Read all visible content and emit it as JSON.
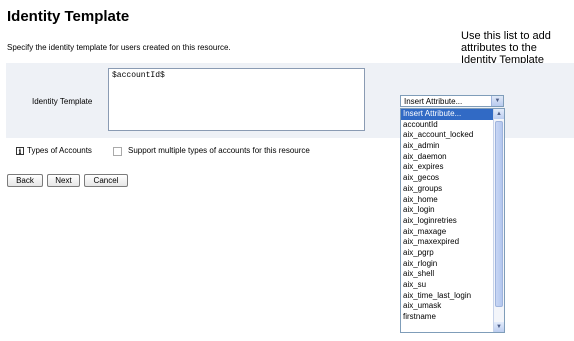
{
  "page": {
    "title": "Identity Template",
    "description": "Specify the identity template for users created on this resource."
  },
  "callout": {
    "text": "Use this list to add attributes to the Identity Template",
    "line_color": "#e13b21"
  },
  "form": {
    "identity_label": "Identity Template",
    "identity_value": "$accountId$",
    "insert_select": {
      "selected": "Insert Attribute...",
      "options": [
        "Insert Attribute...",
        "accountId",
        "aix_account_locked",
        "aix_admin",
        "aix_daemon",
        "aix_expires",
        "aix_gecos",
        "aix_groups",
        "aix_home",
        "aix_login",
        "aix_loginretries",
        "aix_maxage",
        "aix_maxexpired",
        "aix_pgrp",
        "aix_rlogin",
        "aix_shell",
        "aix_su",
        "aix_time_last_login",
        "aix_umask",
        "firstname"
      ]
    },
    "types_label": "Types of Accounts",
    "multi_checkbox_label": "Support multiple types of accounts for this resource",
    "multi_checkbox_checked": false
  },
  "buttons": {
    "back": "Back",
    "next": "Next",
    "cancel": "Cancel"
  },
  "colors": {
    "panel_bg": "#eef1f6",
    "selection": "#316ac5"
  }
}
